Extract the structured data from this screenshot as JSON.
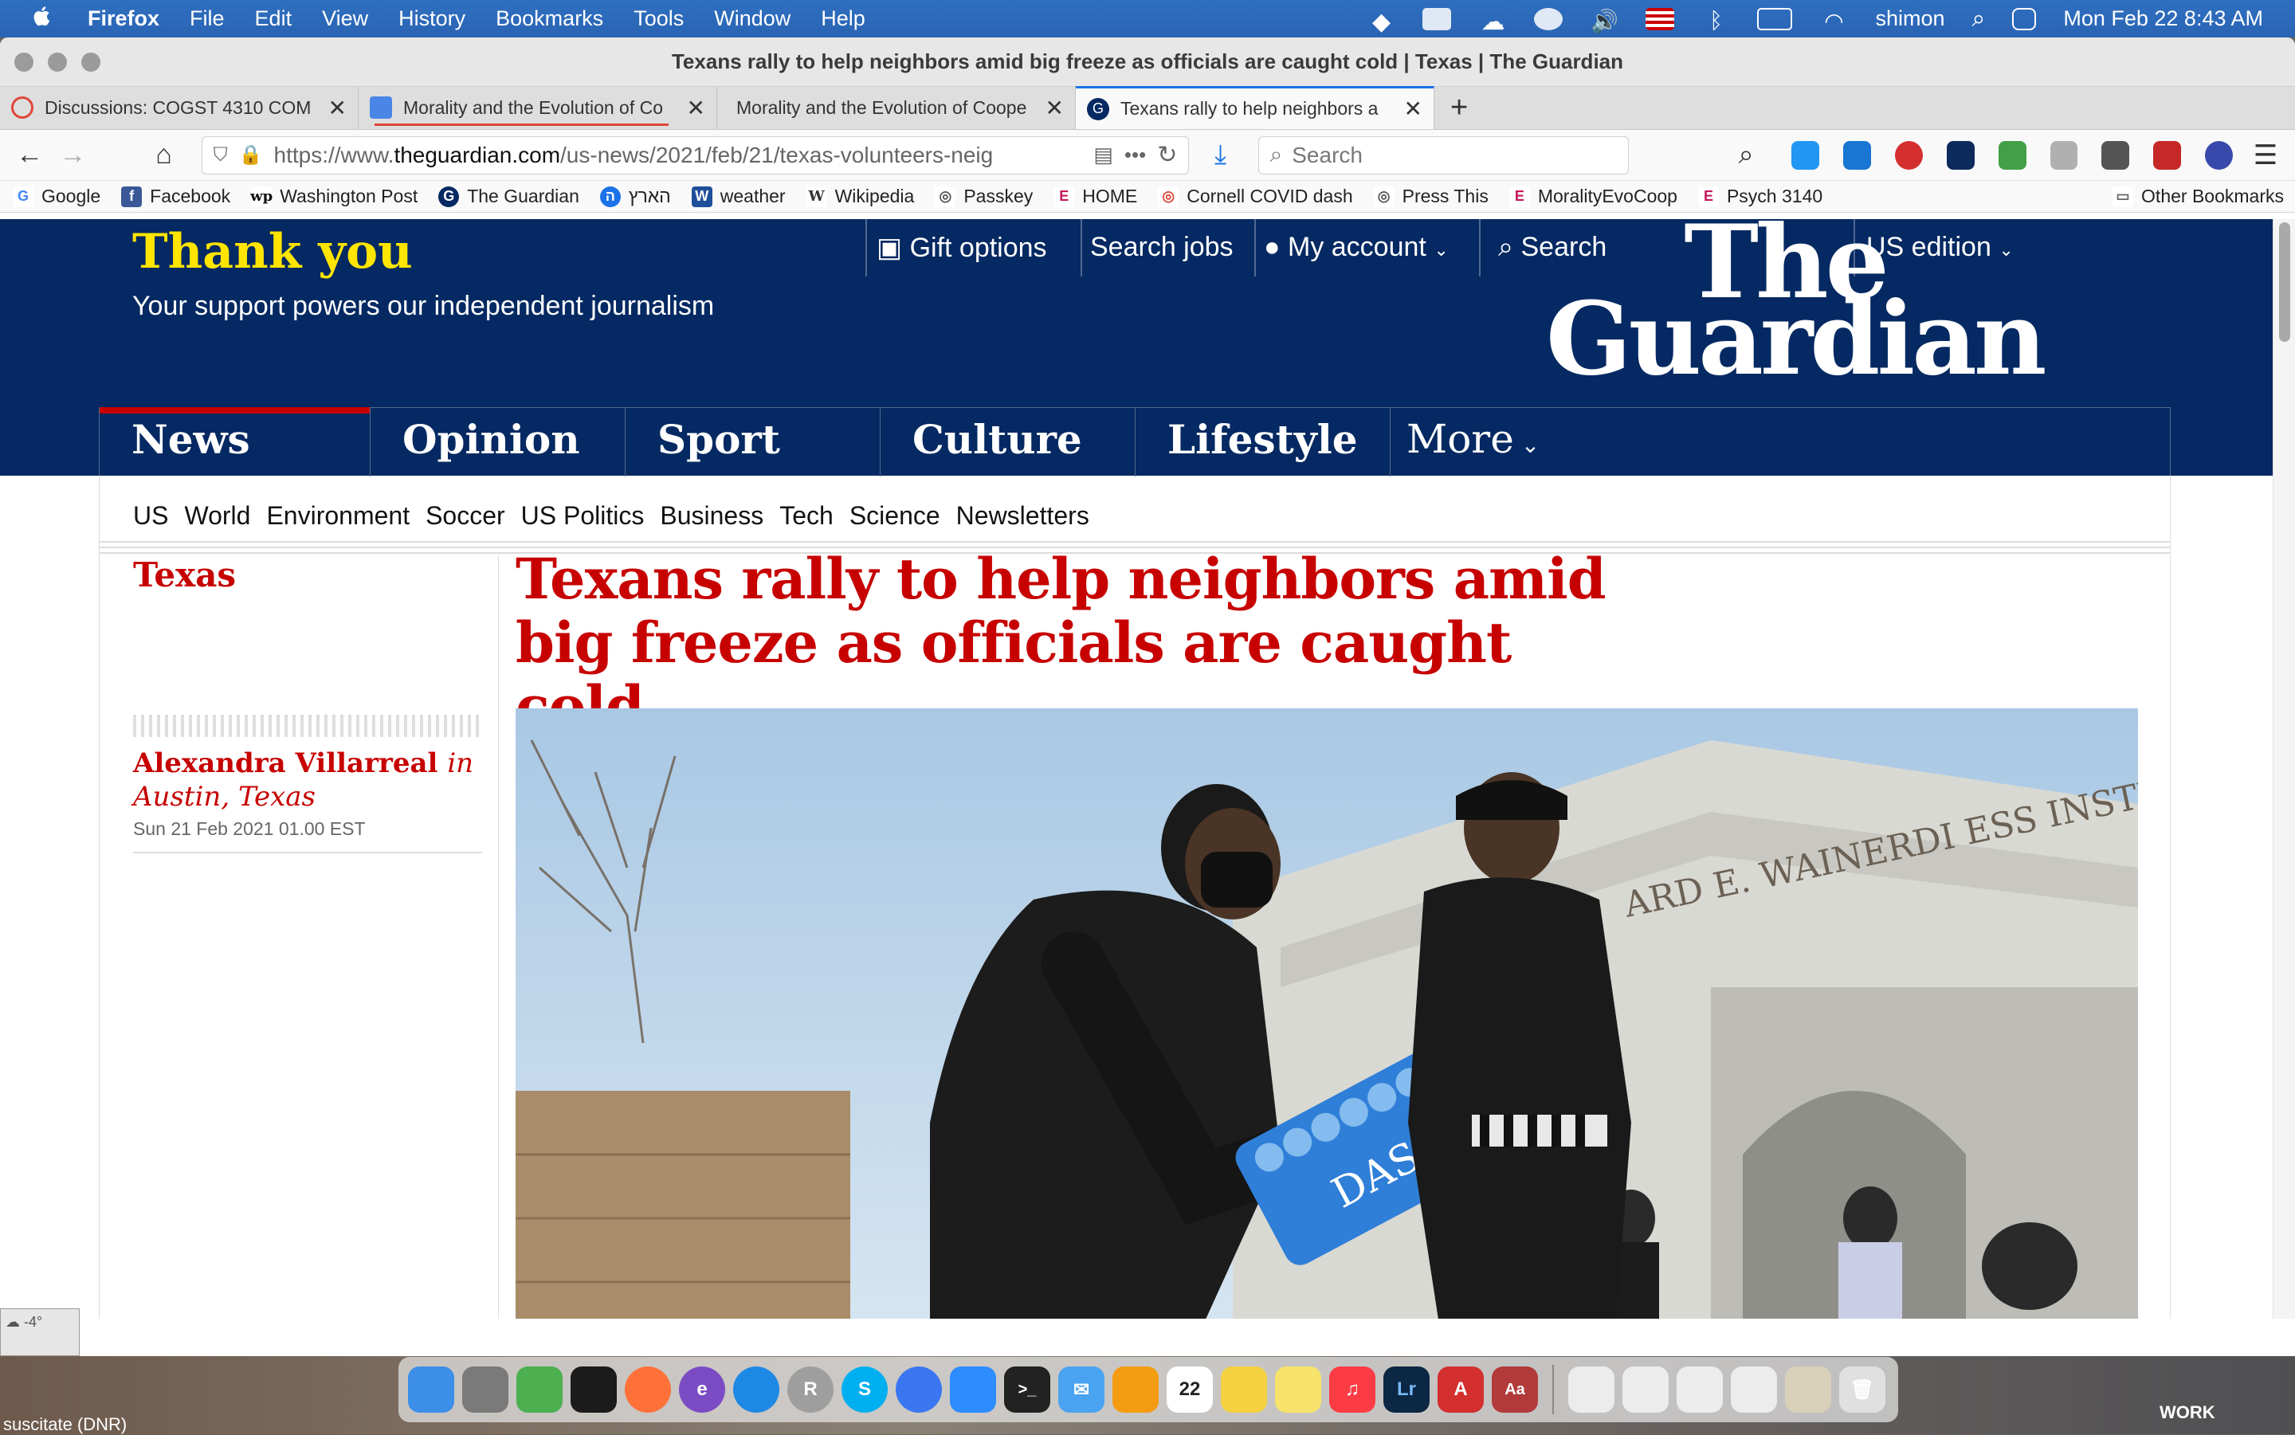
{
  "menubar": {
    "app": "Firefox",
    "items": [
      "File",
      "Edit",
      "View",
      "History",
      "Bookmarks",
      "Tools",
      "Window",
      "Help"
    ],
    "user": "shimon",
    "clock": "Mon Feb 22  8:43 AM"
  },
  "window": {
    "title": "Texans rally to help neighbors amid big freeze as officials are caught cold | Texas | The Guardian"
  },
  "tabs": [
    {
      "label": "Discussions: COGST 4310 COM",
      "favicon_color": "#e0463a"
    },
    {
      "label": "Morality and the Evolution of Co",
      "favicon_color": "#4a86e8"
    },
    {
      "label": "Morality and the Evolution of Coope",
      "favicon_color": "#dedede"
    },
    {
      "label": "Texans rally to help neighbors a",
      "favicon_color": "#052962"
    }
  ],
  "navbar": {
    "url_prefix": "https://www.",
    "url_domain": "theguardian.com",
    "url_path": "/us-news/2021/feb/21/texas-volunteers-neig",
    "search_placeholder": "Search"
  },
  "bookmarks": {
    "items": [
      {
        "label": "Google",
        "color": "#4285f4",
        "glyph": "G"
      },
      {
        "label": "Facebook",
        "color": "#3b5998",
        "glyph": "f"
      },
      {
        "label": "Washington Post",
        "color": "#111111",
        "glyph": "wp"
      },
      {
        "label": "The Guardian",
        "color": "#052962",
        "glyph": "G"
      },
      {
        "label": "הארץ",
        "color": "#1b73e8",
        "glyph": "ה"
      },
      {
        "label": "weather",
        "color": "#1f4e9a",
        "glyph": "W"
      },
      {
        "label": "Wikipedia",
        "color": "#666666",
        "glyph": "W"
      },
      {
        "label": "Passkey",
        "color": "#555555",
        "glyph": "◎"
      },
      {
        "label": "HOME",
        "color": "#c2185b",
        "glyph": "E"
      },
      {
        "label": "Cornell COVID dash",
        "color": "#e0463a",
        "glyph": "◎"
      },
      {
        "label": "Press This",
        "color": "#555555",
        "glyph": "◎"
      },
      {
        "label": "MoralityEvoCoop",
        "color": "#c2185b",
        "glyph": "E"
      },
      {
        "label": "Psych 3140",
        "color": "#c2185b",
        "glyph": "E"
      }
    ],
    "other": "Other Bookmarks"
  },
  "guardian": {
    "thank_you": "Thank you",
    "support": "Your support powers our independent journalism",
    "links": {
      "gift": "Gift options",
      "jobs": "Search jobs",
      "account": "My account",
      "search": "Search",
      "edition": "US edition"
    },
    "logo_line1": "The",
    "logo_line2": "Guardian",
    "pillars": [
      "News",
      "Opinion",
      "Sport",
      "Culture",
      "Lifestyle"
    ],
    "more": "More",
    "subnav": [
      "US",
      "World",
      "Environment",
      "Soccer",
      "US Politics",
      "Business",
      "Tech",
      "Science",
      "Newsletters"
    ]
  },
  "article": {
    "kicker": "Texas",
    "headline": "Texans rally to help neighbors amid big freeze as officials are caught cold",
    "author": "Alexandra Villarreal",
    "author_location": "in Austin, Texas",
    "date": "Sun 21 Feb 2021 01.00 EST",
    "image_text_building": "ARD E. WAINERDI ESS INSTITUTE",
    "image_text_bottle": "DASANI"
  },
  "desktop": {
    "widget_temp": "-4°",
    "left_label": "suscitate (DNR)",
    "right_label": "WORK"
  },
  "dock": {
    "apps": [
      {
        "name": "finder",
        "color": "#3d8ee8",
        "glyph": ""
      },
      {
        "name": "system-preferences",
        "color": "#7a7a7a",
        "glyph": ""
      },
      {
        "name": "maps-app",
        "color": "#4caf50",
        "glyph": ""
      },
      {
        "name": "kindle",
        "color": "#1b1b1b",
        "glyph": ""
      },
      {
        "name": "firefox",
        "color": "#ff7139",
        "glyph": ""
      },
      {
        "name": "emacs",
        "color": "#7b4bc4",
        "glyph": "e"
      },
      {
        "name": "safari",
        "color": "#1e88e5",
        "glyph": ""
      },
      {
        "name": "r-studio",
        "color": "#9e9e9e",
        "glyph": "R"
      },
      {
        "name": "skype",
        "color": "#00aff0",
        "glyph": "S"
      },
      {
        "name": "signal",
        "color": "#3a76f0",
        "glyph": ""
      },
      {
        "name": "zoom",
        "color": "#2d8cff",
        "glyph": ""
      },
      {
        "name": "terminal",
        "color": "#222222",
        "glyph": ">_"
      },
      {
        "name": "mail",
        "color": "#4aa3f0",
        "glyph": ""
      },
      {
        "name": "rss-reader",
        "color": "#f39c12",
        "glyph": ""
      },
      {
        "name": "calendar",
        "color": "#ffffff",
        "glyph": "22"
      },
      {
        "name": "notes",
        "color": "#f5d142",
        "glyph": ""
      },
      {
        "name": "stickies",
        "color": "#f7e36b",
        "glyph": ""
      },
      {
        "name": "music",
        "color": "#fc3c44",
        "glyph": "♫"
      },
      {
        "name": "lightroom",
        "color": "#0b2743",
        "glyph": "Lr"
      },
      {
        "name": "acrobat",
        "color": "#d32f2f",
        "glyph": "A"
      },
      {
        "name": "dictionary",
        "color": "#b23a3a",
        "glyph": "Aa"
      }
    ]
  }
}
